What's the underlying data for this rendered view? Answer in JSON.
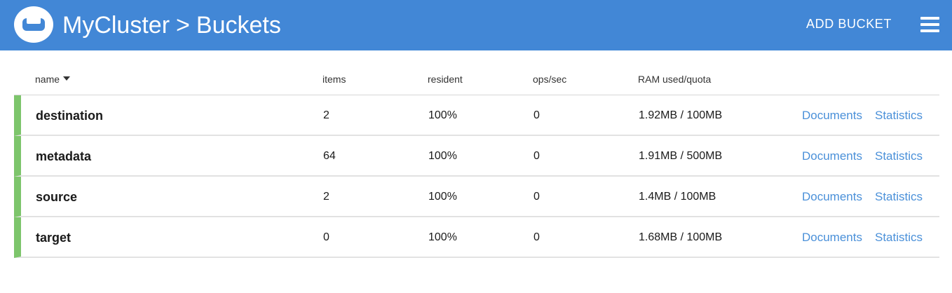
{
  "header": {
    "cluster": "MyCluster",
    "separator": ">",
    "page": "Buckets",
    "add_bucket_label": "ADD BUCKET",
    "background_color": "#4287d6"
  },
  "table": {
    "columns": {
      "name": "name",
      "items": "items",
      "resident": "resident",
      "ops": "ops/sec",
      "ram": "RAM used/quota"
    },
    "rows": [
      {
        "name": "destination",
        "items": "2",
        "resident": "100%",
        "ops": "0",
        "ram": "1.92MB / 100MB",
        "documents": "Documents",
        "statistics": "Statistics",
        "status_color": "#7dc56b"
      },
      {
        "name": "metadata",
        "items": "64",
        "resident": "100%",
        "ops": "0",
        "ram": "1.91MB / 500MB",
        "documents": "Documents",
        "statistics": "Statistics",
        "status_color": "#7dc56b"
      },
      {
        "name": "source",
        "items": "2",
        "resident": "100%",
        "ops": "0",
        "ram": "1.4MB / 100MB",
        "documents": "Documents",
        "statistics": "Statistics",
        "status_color": "#7dc56b"
      },
      {
        "name": "target",
        "items": "0",
        "resident": "100%",
        "ops": "0",
        "ram": "1.68MB / 100MB",
        "documents": "Documents",
        "statistics": "Statistics",
        "status_color": "#7dc56b"
      }
    ]
  },
  "icons": {
    "logo": "couchbase-logo-icon",
    "sort": "caret-down-icon",
    "menu": "hamburger-menu-icon"
  }
}
